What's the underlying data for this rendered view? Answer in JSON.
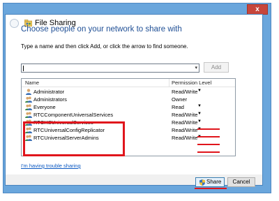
{
  "window": {
    "title": "File Sharing",
    "close_glyph": "x"
  },
  "main": {
    "heading": "Choose people on your network to share with",
    "instruction": "Type a name and then click Add, or click the arrow to find someone.",
    "name_input_value": "",
    "add_label": "Add",
    "dropdown_glyph": "▾"
  },
  "list": {
    "columns": {
      "name": "Name",
      "permission": "Permission Level"
    },
    "rows": [
      {
        "name": "Administrator",
        "permission": "Read/Write",
        "has_dropdown": true,
        "icon": "user-icon"
      },
      {
        "name": "Administrators",
        "permission": "Owner",
        "has_dropdown": false,
        "icon": "group-icon"
      },
      {
        "name": "Everyone",
        "permission": "Read",
        "has_dropdown": true,
        "icon": "group-icon"
      },
      {
        "name": "RTCComponentUniversalServices",
        "permission": "Read/Write",
        "has_dropdown": true,
        "icon": "group-icon"
      },
      {
        "name": "RTCHSUniversalServices",
        "permission": "Read/Write",
        "has_dropdown": true,
        "icon": "group-icon"
      },
      {
        "name": "RTCUniversalConfigReplicator",
        "permission": "Read/Write",
        "has_dropdown": true,
        "icon": "group-icon"
      },
      {
        "name": "RTCUniversalServerAdmins",
        "permission": "Read/Write",
        "has_dropdown": true,
        "icon": "group-icon"
      }
    ],
    "arrow_glyph": "▼"
  },
  "links": {
    "trouble": "I'm having trouble sharing"
  },
  "buttons": {
    "share": "Share",
    "cancel": "Cancel"
  },
  "colors": {
    "title_bar": "#6aa6dc",
    "heading": "#1f4f95",
    "link": "#0a58c2",
    "annotation_red": "#e0151c",
    "close_button": "#c7463b"
  }
}
